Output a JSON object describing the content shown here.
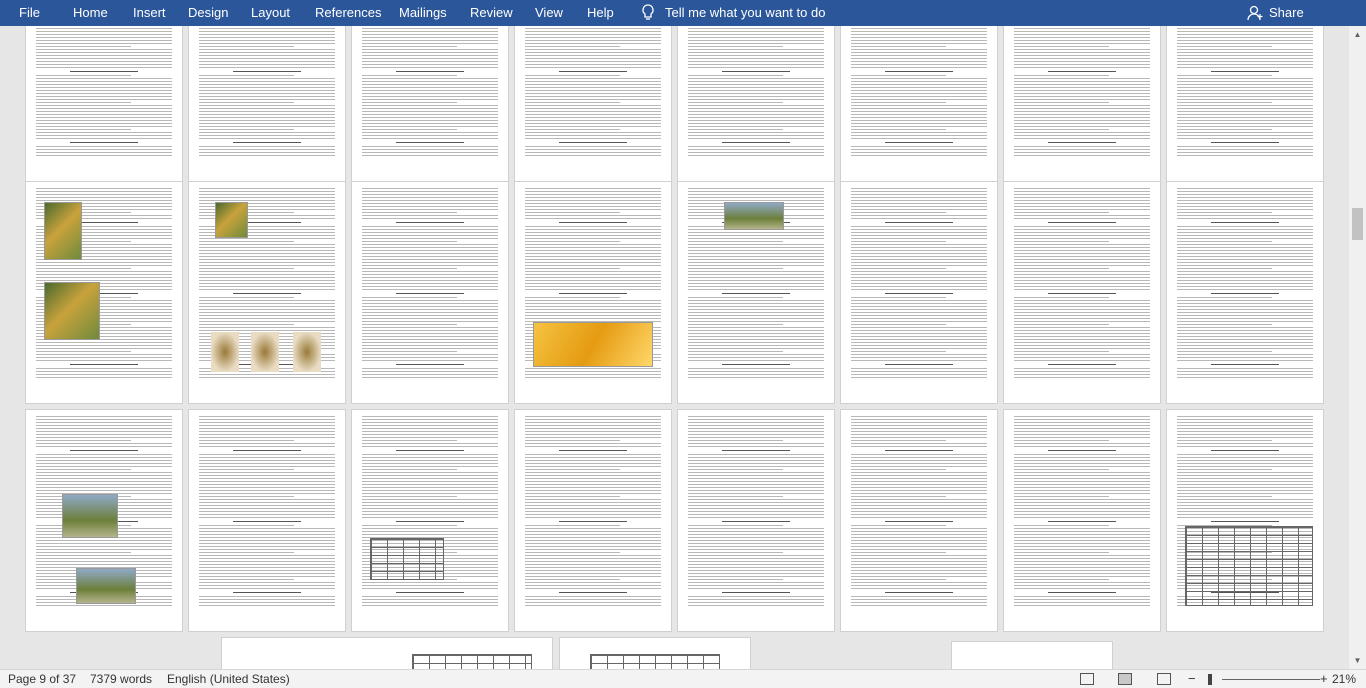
{
  "menu": {
    "tabs": [
      "File",
      "Home",
      "Insert",
      "Design",
      "Layout",
      "References",
      "Mailings",
      "Review",
      "View",
      "Help"
    ],
    "tell_me": "Tell me what you want to do",
    "share": "Share",
    "icons": {
      "tell_me": "lightbulb-icon",
      "share": "person-icon"
    }
  },
  "status": {
    "page": "Page 9 of 37",
    "words": "7379 words",
    "language": "English (United States)",
    "zoom": "21%",
    "zoom_minus": "−",
    "zoom_plus": "+"
  },
  "colors": {
    "ribbon": "#2b579a",
    "canvas": "#e6e6e6",
    "page": "#ffffff",
    "status_bar": "#f3f3f3"
  }
}
